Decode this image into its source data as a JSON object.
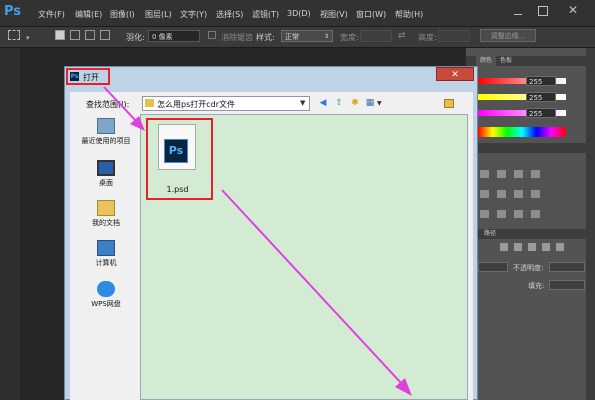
{
  "app": {
    "logo": "Ps"
  },
  "menu": [
    {
      "label": "文件(F)"
    },
    {
      "label": "编辑(E)"
    },
    {
      "label": "图像(I)"
    },
    {
      "label": "图层(L)"
    },
    {
      "label": "文字(Y)"
    },
    {
      "label": "选择(S)"
    },
    {
      "label": "滤镜(T)"
    },
    {
      "label": "3D(D)"
    },
    {
      "label": "视图(V)"
    },
    {
      "label": "窗口(W)"
    },
    {
      "label": "帮助(H)"
    }
  ],
  "window_controls": {
    "close": "✕"
  },
  "options_bar": {
    "feather_label": "羽化:",
    "feather_value": "0 像素",
    "antialias_label": "消除锯齿",
    "style_label": "样式:",
    "style_value": "正常",
    "width_label": "宽度:",
    "height_label": "高度:",
    "refine_edge_label": "调整边缘..."
  },
  "panels": {
    "color_tabs": [
      "颜色",
      "色板"
    ],
    "color_values": [
      "255",
      "255",
      "255"
    ],
    "adjust_tabs": [
      ""
    ],
    "paths_tab": "路径",
    "opacity_label": "不透明度:",
    "fill_label": "填充:"
  },
  "dialog": {
    "title": "打开",
    "ps_icon": "Ps",
    "close_label": "✕",
    "lookin_label": "查找范围(I):",
    "lookin_value": "怎么用ps打开cdr文件",
    "places": [
      {
        "label": "最近使用的项目",
        "icon": "recent-icon"
      },
      {
        "label": "桌面",
        "icon": "desktop-icon"
      },
      {
        "label": "我的文档",
        "icon": "documents-icon"
      },
      {
        "label": "计算机",
        "icon": "computer-icon"
      },
      {
        "label": "WPS网盘",
        "icon": "cloud-icon"
      }
    ],
    "files": [
      {
        "name": "1.psd",
        "icon_text": "Ps",
        "icon": "psd-file-icon"
      }
    ]
  },
  "colors": {
    "highlight": "#e8202a",
    "annotation_arrow": "#e040e0",
    "file_pane_bg": "#d3ebd3"
  }
}
